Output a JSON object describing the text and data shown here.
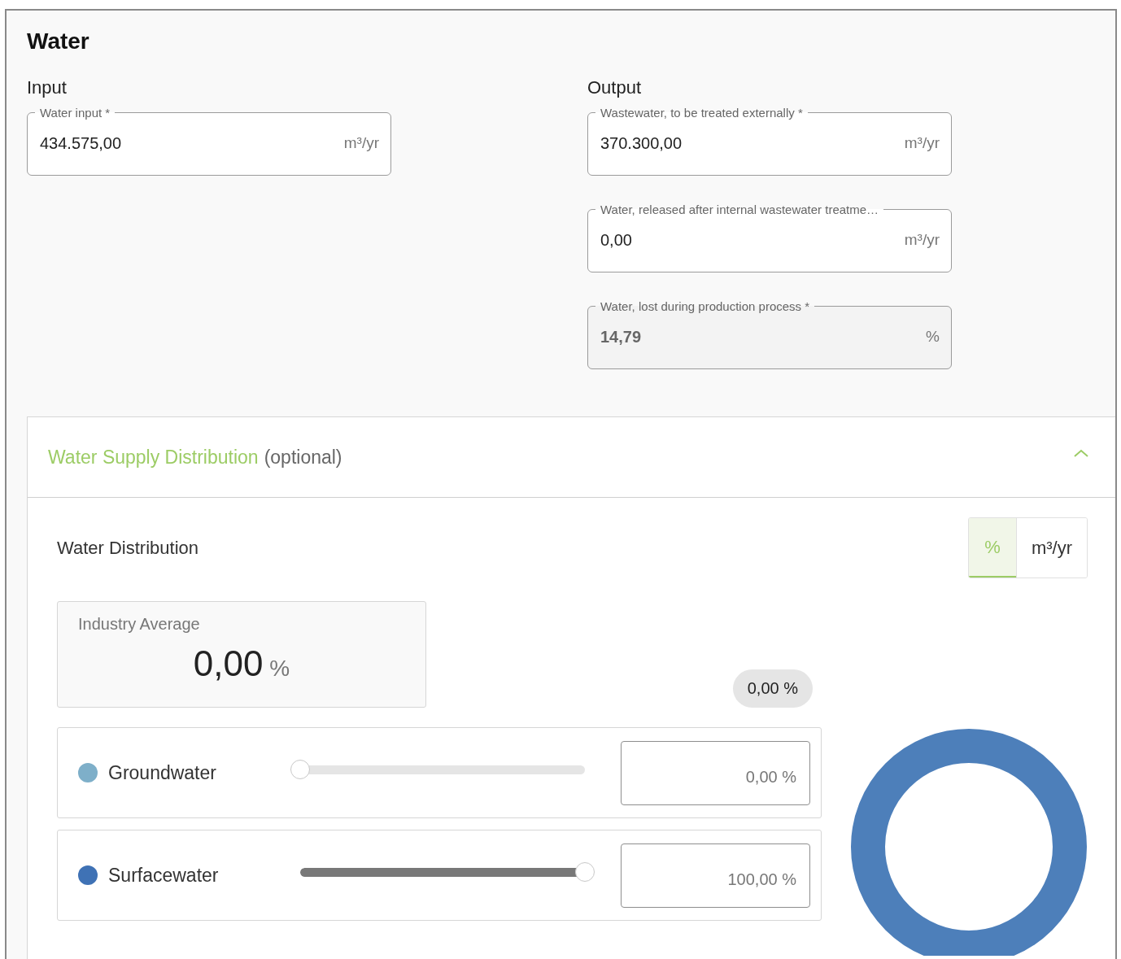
{
  "title": "Water",
  "input": {
    "heading": "Input",
    "fields": [
      {
        "label": "Water input *",
        "value": "434.575,00",
        "unit": "m³/yr",
        "disabled": false
      }
    ]
  },
  "output": {
    "heading": "Output",
    "fields": [
      {
        "label": "Wastewater, to be treated externally *",
        "value": "370.300,00",
        "unit": "m³/yr",
        "disabled": false
      },
      {
        "label": "Water, released after internal wastewater treatme…",
        "value": "0,00",
        "unit": "m³/yr",
        "disabled": false
      },
      {
        "label": "Water, lost during production process *",
        "value": "14,79",
        "unit": "%",
        "disabled": true
      }
    ]
  },
  "accordion": {
    "title": "Water Supply Distribution",
    "suffix": "(optional)",
    "expanded": true,
    "section_title": "Water Distribution",
    "unit_toggle": [
      {
        "label": "%",
        "selected": true
      },
      {
        "label": "m³/yr",
        "selected": false
      }
    ],
    "industry_average": {
      "label": "Industry Average",
      "value": "0,00",
      "unit": "%"
    },
    "total_badge": "0,00 %",
    "sources": [
      {
        "name": "Groundwater",
        "color": "#7eafc9",
        "level": 0,
        "reading": "0,00 %"
      },
      {
        "name": "Surfacewater",
        "color": "#3f72b5",
        "level": 1,
        "reading": "100,00 %"
      }
    ]
  }
}
